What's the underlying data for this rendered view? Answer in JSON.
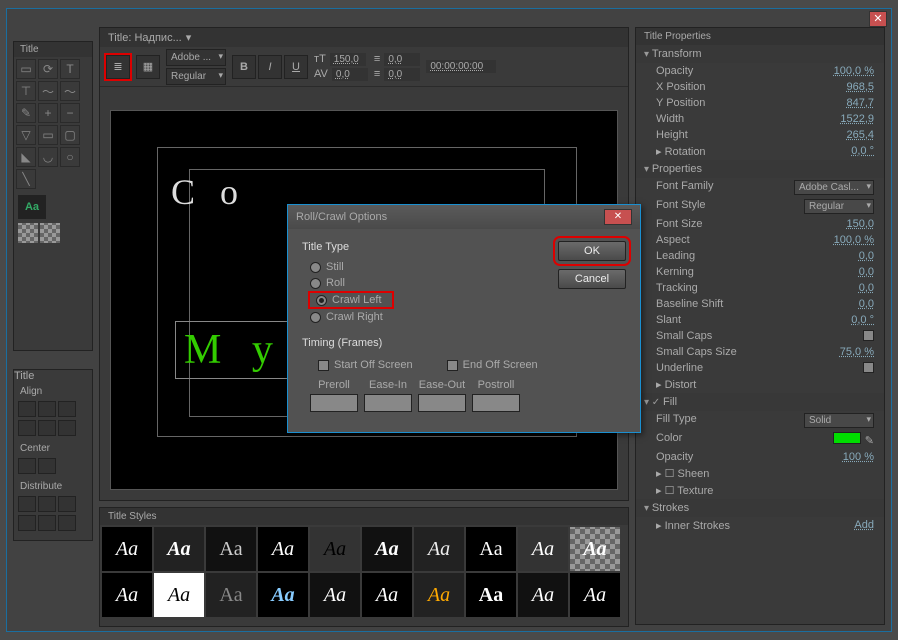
{
  "window": {
    "close": "✕"
  },
  "leftTools": {
    "title": "Title",
    "aa": "Aa"
  },
  "leftActions": {
    "title": "Title",
    "align": "Align",
    "center": "Center",
    "distribute": "Distribute"
  },
  "canvas": {
    "title": "Title: Надпис...",
    "menu": "≡",
    "font": "Adobe ...",
    "style": "Regular",
    "bold": "B",
    "italic": "I",
    "under": "U",
    "size": "150,0",
    "leading": "0,0",
    "kern1": "0,0",
    "kern2": "0,0",
    "tc": "00:00:00:00",
    "text1": "С о",
    "text2": "М у л"
  },
  "styles": {
    "title": "Title Styles",
    "items": [
      "Aa",
      "Aa",
      "Aa",
      "Aa",
      "Aa",
      "Aa",
      "Aa",
      "Aa",
      "Aa",
      "Aa",
      "Aa",
      "Aa",
      "Aa",
      "Aa",
      "Aa",
      "Aa",
      "Aa",
      "Aa",
      "Aa",
      "Aa"
    ]
  },
  "props": {
    "title": "Title Properties",
    "transform": "Transform",
    "opacity": "Opacity",
    "opacity_v": "100,0 %",
    "xpos": "X Position",
    "xpos_v": "968,5",
    "ypos": "Y Position",
    "ypos_v": "847,7",
    "width": "Width",
    "width_v": "1522,9",
    "height": "Height",
    "height_v": "265,4",
    "rotation": "Rotation",
    "rotation_v": "0,0 °",
    "properties": "Properties",
    "ffam": "Font Family",
    "ffam_v": "Adobe Casl...",
    "fsty": "Font Style",
    "fsty_v": "Regular",
    "fsize": "Font Size",
    "fsize_v": "150,0",
    "aspect": "Aspect",
    "aspect_v": "100,0 %",
    "lead": "Leading",
    "lead_v": "0,0",
    "kern": "Kerning",
    "kern_v": "0,0",
    "track": "Tracking",
    "track_v": "0,0",
    "bshift": "Baseline Shift",
    "bshift_v": "0,0",
    "slant": "Slant",
    "slant_v": "0,0 °",
    "scaps": "Small Caps",
    "scsize": "Small Caps Size",
    "scsize_v": "75,0 %",
    "uline": "Underline",
    "distort": "Distort",
    "fill": "Fill",
    "ftype": "Fill Type",
    "ftype_v": "Solid",
    "color": "Color",
    "fop": "Opacity",
    "fop_v": "100 %",
    "sheen": "Sheen",
    "texture": "Texture",
    "strokes": "Strokes",
    "istrokes": "Inner Strokes",
    "add": "Add"
  },
  "dialog": {
    "title": "Roll/Crawl Options",
    "titleType": "Title Type",
    "still": "Still",
    "roll": "Roll",
    "crawlLeft": "Crawl Left",
    "crawlRight": "Crawl Right",
    "timing": "Timing (Frames)",
    "startOff": "Start Off Screen",
    "endOff": "End Off Screen",
    "preroll": "Preroll",
    "easeIn": "Ease-In",
    "easeOut": "Ease-Out",
    "postroll": "Postroll",
    "ok": "OK",
    "cancel": "Cancel",
    "close": "✕"
  }
}
